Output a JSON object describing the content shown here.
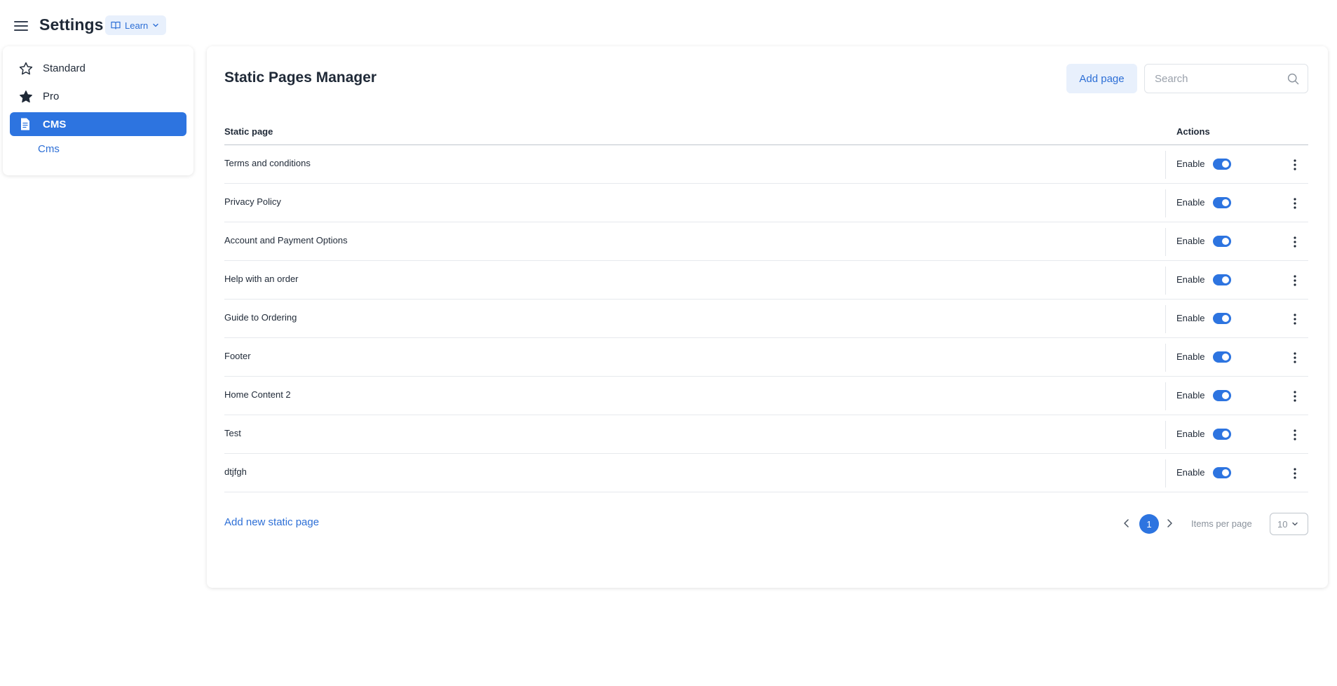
{
  "header": {
    "title": "Settings",
    "learn_label": "Learn"
  },
  "sidebar": {
    "items": [
      {
        "label": "Standard",
        "icon": "star-outline-icon"
      },
      {
        "label": "Pro",
        "icon": "star-filled-icon"
      },
      {
        "label": "CMS",
        "icon": "document-icon",
        "active": true
      }
    ],
    "sub_item": "Cms"
  },
  "main": {
    "title": "Static Pages Manager",
    "add_button": "Add page",
    "search_placeholder": "Search",
    "columns": {
      "page": "Static page",
      "actions": "Actions"
    },
    "rows": [
      {
        "name": "Terms and conditions",
        "status": "Enable"
      },
      {
        "name": "Privacy Policy",
        "status": "Enable"
      },
      {
        "name": "Account and Payment Options",
        "status": "Enable"
      },
      {
        "name": "Help with an order",
        "status": "Enable"
      },
      {
        "name": "Guide to Ordering",
        "status": "Enable"
      },
      {
        "name": "Footer",
        "status": "Enable"
      },
      {
        "name": "Home Content 2",
        "status": "Enable"
      },
      {
        "name": "Test",
        "status": "Enable"
      },
      {
        "name": "dtjfgh",
        "status": "Enable"
      }
    ],
    "add_static_link": "Add new static page",
    "pagination": {
      "current_page": "1",
      "items_per_page_label": "Items per page",
      "items_per_page": "10"
    }
  },
  "colors": {
    "accent": "#2d74e0",
    "accent_soft": "#e8f0fc",
    "text": "#1f2937"
  }
}
